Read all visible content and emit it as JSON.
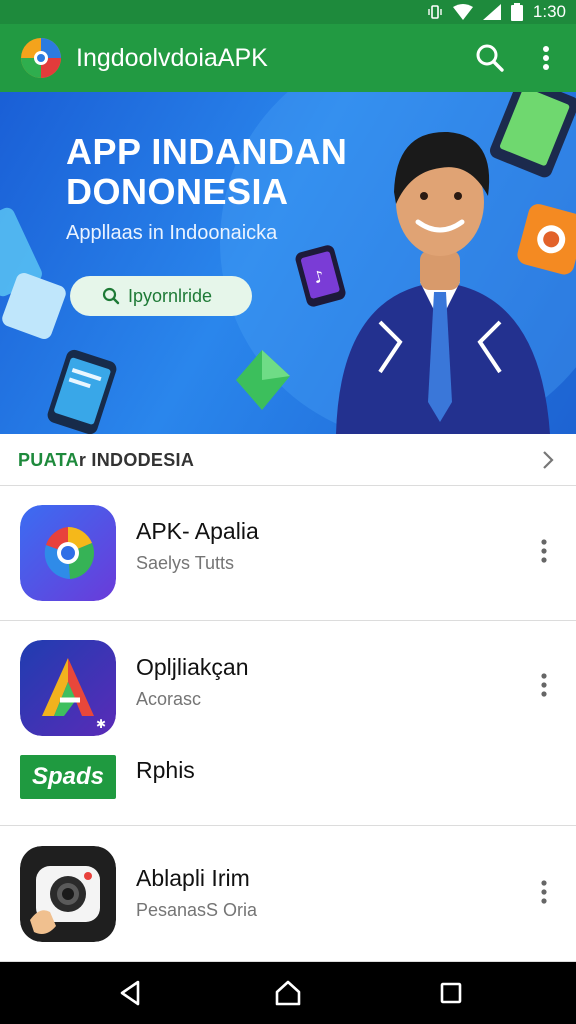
{
  "status_bar": {
    "time": "1:30"
  },
  "app_bar": {
    "title": "IngdoolvdoiaAPK"
  },
  "banner": {
    "title": "APP INDANDAN DONONESIA",
    "subtitle": "Appllaas in Indoonaicka",
    "search_label": "Ipyornlride"
  },
  "section": {
    "title_accent": "PUATA",
    "title_rest": "r INDODESIA"
  },
  "apps": [
    {
      "name": "APK- Apalia",
      "subtitle": "Saelys Tutts"
    },
    {
      "name": "Opljliakçan",
      "subtitle": "Acorasc",
      "extra_badge": "Spads",
      "extra_name": "Rphis"
    },
    {
      "name": "Ablapli Irim",
      "subtitle": "PesanasS Oria"
    }
  ],
  "colors": {
    "app_bar": "#229a42",
    "status_bar": "#1e8a3c",
    "banner": "#2a86ec",
    "accent": "#1e8a3c"
  }
}
